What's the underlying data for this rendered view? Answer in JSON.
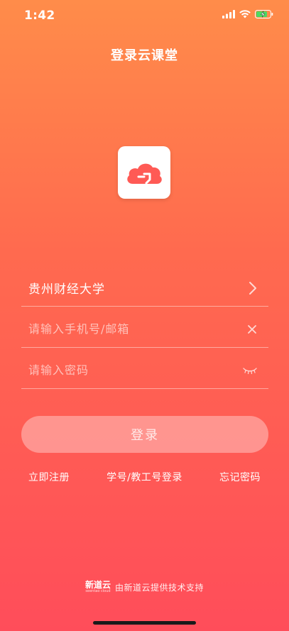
{
  "status_bar": {
    "time": "1:42",
    "icons": [
      "signal-icon",
      "wifi-icon",
      "battery-charging-icon"
    ]
  },
  "header": {
    "title": "登录云课堂"
  },
  "logo": {
    "icon": "cloud-logo-icon",
    "colors": {
      "accent": "#ff5a55",
      "background": "#ffffff"
    }
  },
  "form": {
    "school": {
      "value": "贵州财经大学",
      "trailing_icon": "chevron-right-icon"
    },
    "account": {
      "placeholder": "请输入手机号/邮箱",
      "value": "",
      "trailing_icon": "clear-icon"
    },
    "password": {
      "placeholder": "请输入密码",
      "value": "",
      "trailing_icon": "eye-closed-icon"
    }
  },
  "login_button": {
    "label": "登录"
  },
  "links": {
    "register": "立即注册",
    "student_login": "学号/教工号登录",
    "forgot_password": "忘记密码"
  },
  "footer": {
    "brand": "新道云",
    "brand_sub": "seentao cloud",
    "text": "由新道云提供技术支持"
  },
  "colors": {
    "gradient_top": "#ff8c4a",
    "gradient_bottom": "#ff4d5a",
    "text": "#ffffff"
  }
}
